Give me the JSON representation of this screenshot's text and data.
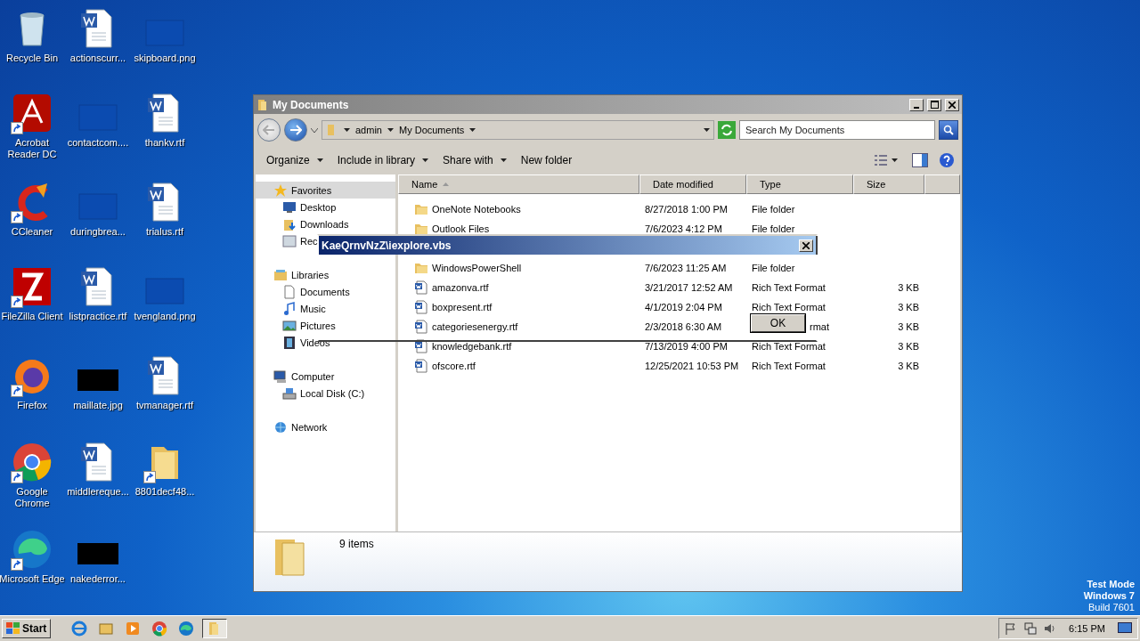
{
  "desktop_icons": [
    {
      "label": "Recycle Bin",
      "kind": "recycle",
      "shortcut": false
    },
    {
      "label": "Acrobat Reader DC",
      "kind": "acrobat",
      "shortcut": true
    },
    {
      "label": "CCleaner",
      "kind": "ccleaner",
      "shortcut": true
    },
    {
      "label": "FileZilla Client",
      "kind": "filezilla",
      "shortcut": true
    },
    {
      "label": "Firefox",
      "kind": "firefox",
      "shortcut": true
    },
    {
      "label": "Google Chrome",
      "kind": "chrome",
      "shortcut": true
    },
    {
      "label": "Microsoft Edge",
      "kind": "edge",
      "shortcut": true
    },
    {
      "label": "actionscurr...",
      "kind": "word",
      "shortcut": false
    },
    {
      "label": "contactcom....",
      "kind": "blank",
      "shortcut": false
    },
    {
      "label": "duringbrea...",
      "kind": "blank",
      "shortcut": false
    },
    {
      "label": "listpractice.rtf",
      "kind": "word",
      "shortcut": false
    },
    {
      "label": "maillate.jpg",
      "kind": "black",
      "shortcut": false
    },
    {
      "label": "middlereque...",
      "kind": "word",
      "shortcut": false
    },
    {
      "label": "nakederror...",
      "kind": "black",
      "shortcut": false
    },
    {
      "label": "skipboard.png",
      "kind": "blank",
      "shortcut": false
    },
    {
      "label": "thankv.rtf",
      "kind": "word",
      "shortcut": false
    },
    {
      "label": "trialus.rtf",
      "kind": "word",
      "shortcut": false
    },
    {
      "label": "tvengland.png",
      "kind": "blank",
      "shortcut": false
    },
    {
      "label": "tvmanager.rtf",
      "kind": "word",
      "shortcut": false
    },
    {
      "label": "8801decf48...",
      "kind": "folder",
      "shortcut": true
    }
  ],
  "explorer": {
    "title": "My Documents",
    "breadcrumb": [
      "admin",
      "My Documents"
    ],
    "search": {
      "placeholder": "Search My Documents"
    },
    "toolbar": [
      {
        "label": "Organize",
        "dropdown": true
      },
      {
        "label": "Include in library",
        "dropdown": true
      },
      {
        "label": "Share with",
        "dropdown": true
      },
      {
        "label": "New folder",
        "dropdown": false
      }
    ],
    "sidebar": [
      {
        "label": "Favorites",
        "kind": "star",
        "selected": true,
        "children": [
          {
            "label": "Desktop",
            "kind": "desktop",
            "selected": false
          },
          {
            "label": "Downloads",
            "kind": "downloads",
            "selected": false
          },
          {
            "label": "Rec",
            "kind": "recent",
            "selected": false
          }
        ]
      },
      {
        "label": "Libraries",
        "kind": "libraries",
        "selected": false,
        "children": [
          {
            "label": "Documents",
            "kind": "documents",
            "selected": false
          },
          {
            "label": "Music",
            "kind": "music",
            "selected": false
          },
          {
            "label": "Pictures",
            "kind": "pictures",
            "selected": false
          },
          {
            "label": "Videos",
            "kind": "videos",
            "selected": false
          }
        ]
      },
      {
        "label": "Computer",
        "kind": "computer",
        "selected": false,
        "children": [
          {
            "label": "Local Disk (C:)",
            "kind": "disk",
            "selected": false
          }
        ]
      },
      {
        "label": "Network",
        "kind": "network",
        "selected": false
      }
    ],
    "columns": [
      {
        "label": "Name",
        "sorted": true
      },
      {
        "label": "Date modified",
        "sorted": false
      },
      {
        "label": "Type",
        "sorted": false
      },
      {
        "label": "Size",
        "sorted": false
      }
    ],
    "rows": [
      {
        "kind": "folder",
        "name": "OneNote Notebooks",
        "date": "8/27/2018 1:00 PM",
        "type": "File folder"
      },
      {
        "kind": "folder",
        "name": "Outlook Files",
        "date": "7/6/2023 4:12 PM",
        "type": "File folder"
      },
      {
        "kind": "covered"
      },
      {
        "kind": "folder",
        "name": "WindowsPowerShell",
        "date": "7/6/2023 11:25 AM",
        "type": "File folder"
      },
      {
        "kind": "rtf",
        "name": "amazonva.rtf",
        "date": "3/21/2017 12:52 AM",
        "type": "Rich Text Format",
        "size": "3 KB"
      },
      {
        "kind": "rtf",
        "name": "boxpresent.rtf",
        "date": "4/1/2019 2:04 PM",
        "type": "Rich Text Format",
        "size": "3 KB"
      },
      {
        "kind": "rtf",
        "name": "categoriesenergy.rtf",
        "date": "2/3/2018 6:30 AM",
        "type": "rmat",
        "type_partial": true,
        "size": "3 KB"
      },
      {
        "kind": "rtf",
        "name": "knowledgebank.rtf",
        "date": "7/13/2019 4:00 PM",
        "type": "Rich Text Format",
        "size": "3 KB"
      },
      {
        "kind": "rtf",
        "name": "ofscore.rtf",
        "date": "12/25/2021 10:53 PM",
        "type": "Rich Text Format",
        "size": "3 KB"
      }
    ],
    "status": "9 items"
  },
  "dialog": {
    "title": "KaeQrnvNzZ\\iexplore.vbs",
    "button": "OK"
  },
  "taskbar": {
    "start": "Start",
    "apps": [
      {
        "kind": "ie",
        "active": false
      },
      {
        "kind": "explorer",
        "active": false
      },
      {
        "kind": "media",
        "active": false
      },
      {
        "kind": "chrome",
        "active": false
      },
      {
        "kind": "edge",
        "active": false
      },
      {
        "kind": "folder",
        "active": true
      }
    ],
    "clock": "6:15 PM"
  },
  "os_notice": [
    "Test Mode",
    "Windows 7",
    "Build 7601"
  ]
}
